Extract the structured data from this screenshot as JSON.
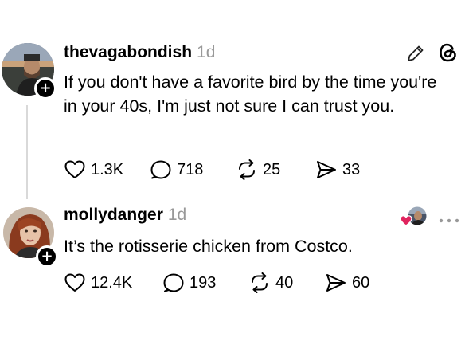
{
  "posts": [
    {
      "username": "thevagabondish",
      "time": "1d",
      "text": "If you don't have a favorite bird by the time you're in your 40s, I'm just not sure I can trust you.",
      "likes": "1.3K",
      "replies": "718",
      "reposts": "25",
      "shares": "33",
      "corner_icons": [
        "pencil-icon",
        "threads-logo-icon"
      ]
    },
    {
      "username": "mollydanger",
      "time": "1d",
      "text": "It’s the rotisserie chicken from Costco.",
      "likes": "12.4K",
      "replies": "193",
      "reposts": "40",
      "shares": "60",
      "corner_icons": [
        "liked-by-author-icon",
        "more-icon"
      ]
    }
  ],
  "colors": {
    "timestamp": "#999999",
    "thread_line": "#d9d9d9",
    "heart_red": "#e0245e"
  }
}
